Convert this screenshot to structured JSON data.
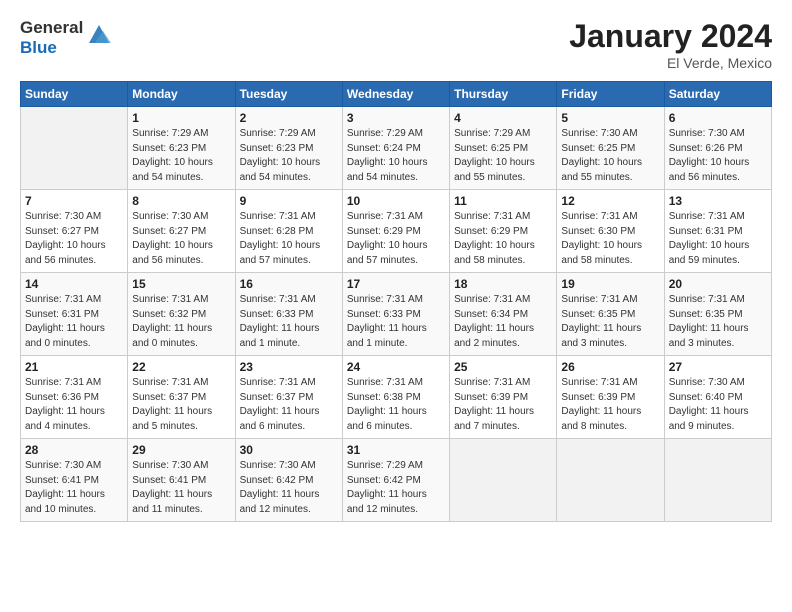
{
  "header": {
    "logo_general": "General",
    "logo_blue": "Blue",
    "title": "January 2024",
    "location": "El Verde, Mexico"
  },
  "columns": [
    "Sunday",
    "Monday",
    "Tuesday",
    "Wednesday",
    "Thursday",
    "Friday",
    "Saturday"
  ],
  "weeks": [
    [
      {
        "num": "",
        "info": ""
      },
      {
        "num": "1",
        "info": "Sunrise: 7:29 AM\nSunset: 6:23 PM\nDaylight: 10 hours\nand 54 minutes."
      },
      {
        "num": "2",
        "info": "Sunrise: 7:29 AM\nSunset: 6:23 PM\nDaylight: 10 hours\nand 54 minutes."
      },
      {
        "num": "3",
        "info": "Sunrise: 7:29 AM\nSunset: 6:24 PM\nDaylight: 10 hours\nand 54 minutes."
      },
      {
        "num": "4",
        "info": "Sunrise: 7:29 AM\nSunset: 6:25 PM\nDaylight: 10 hours\nand 55 minutes."
      },
      {
        "num": "5",
        "info": "Sunrise: 7:30 AM\nSunset: 6:25 PM\nDaylight: 10 hours\nand 55 minutes."
      },
      {
        "num": "6",
        "info": "Sunrise: 7:30 AM\nSunset: 6:26 PM\nDaylight: 10 hours\nand 56 minutes."
      }
    ],
    [
      {
        "num": "7",
        "info": "Sunrise: 7:30 AM\nSunset: 6:27 PM\nDaylight: 10 hours\nand 56 minutes."
      },
      {
        "num": "8",
        "info": "Sunrise: 7:30 AM\nSunset: 6:27 PM\nDaylight: 10 hours\nand 56 minutes."
      },
      {
        "num": "9",
        "info": "Sunrise: 7:31 AM\nSunset: 6:28 PM\nDaylight: 10 hours\nand 57 minutes."
      },
      {
        "num": "10",
        "info": "Sunrise: 7:31 AM\nSunset: 6:29 PM\nDaylight: 10 hours\nand 57 minutes."
      },
      {
        "num": "11",
        "info": "Sunrise: 7:31 AM\nSunset: 6:29 PM\nDaylight: 10 hours\nand 58 minutes."
      },
      {
        "num": "12",
        "info": "Sunrise: 7:31 AM\nSunset: 6:30 PM\nDaylight: 10 hours\nand 58 minutes."
      },
      {
        "num": "13",
        "info": "Sunrise: 7:31 AM\nSunset: 6:31 PM\nDaylight: 10 hours\nand 59 minutes."
      }
    ],
    [
      {
        "num": "14",
        "info": "Sunrise: 7:31 AM\nSunset: 6:31 PM\nDaylight: 11 hours\nand 0 minutes."
      },
      {
        "num": "15",
        "info": "Sunrise: 7:31 AM\nSunset: 6:32 PM\nDaylight: 11 hours\nand 0 minutes."
      },
      {
        "num": "16",
        "info": "Sunrise: 7:31 AM\nSunset: 6:33 PM\nDaylight: 11 hours\nand 1 minute."
      },
      {
        "num": "17",
        "info": "Sunrise: 7:31 AM\nSunset: 6:33 PM\nDaylight: 11 hours\nand 1 minute."
      },
      {
        "num": "18",
        "info": "Sunrise: 7:31 AM\nSunset: 6:34 PM\nDaylight: 11 hours\nand 2 minutes."
      },
      {
        "num": "19",
        "info": "Sunrise: 7:31 AM\nSunset: 6:35 PM\nDaylight: 11 hours\nand 3 minutes."
      },
      {
        "num": "20",
        "info": "Sunrise: 7:31 AM\nSunset: 6:35 PM\nDaylight: 11 hours\nand 3 minutes."
      }
    ],
    [
      {
        "num": "21",
        "info": "Sunrise: 7:31 AM\nSunset: 6:36 PM\nDaylight: 11 hours\nand 4 minutes."
      },
      {
        "num": "22",
        "info": "Sunrise: 7:31 AM\nSunset: 6:37 PM\nDaylight: 11 hours\nand 5 minutes."
      },
      {
        "num": "23",
        "info": "Sunrise: 7:31 AM\nSunset: 6:37 PM\nDaylight: 11 hours\nand 6 minutes."
      },
      {
        "num": "24",
        "info": "Sunrise: 7:31 AM\nSunset: 6:38 PM\nDaylight: 11 hours\nand 6 minutes."
      },
      {
        "num": "25",
        "info": "Sunrise: 7:31 AM\nSunset: 6:39 PM\nDaylight: 11 hours\nand 7 minutes."
      },
      {
        "num": "26",
        "info": "Sunrise: 7:31 AM\nSunset: 6:39 PM\nDaylight: 11 hours\nand 8 minutes."
      },
      {
        "num": "27",
        "info": "Sunrise: 7:30 AM\nSunset: 6:40 PM\nDaylight: 11 hours\nand 9 minutes."
      }
    ],
    [
      {
        "num": "28",
        "info": "Sunrise: 7:30 AM\nSunset: 6:41 PM\nDaylight: 11 hours\nand 10 minutes."
      },
      {
        "num": "29",
        "info": "Sunrise: 7:30 AM\nSunset: 6:41 PM\nDaylight: 11 hours\nand 11 minutes."
      },
      {
        "num": "30",
        "info": "Sunrise: 7:30 AM\nSunset: 6:42 PM\nDaylight: 11 hours\nand 12 minutes."
      },
      {
        "num": "31",
        "info": "Sunrise: 7:29 AM\nSunset: 6:42 PM\nDaylight: 11 hours\nand 12 minutes."
      },
      {
        "num": "",
        "info": ""
      },
      {
        "num": "",
        "info": ""
      },
      {
        "num": "",
        "info": ""
      }
    ]
  ]
}
